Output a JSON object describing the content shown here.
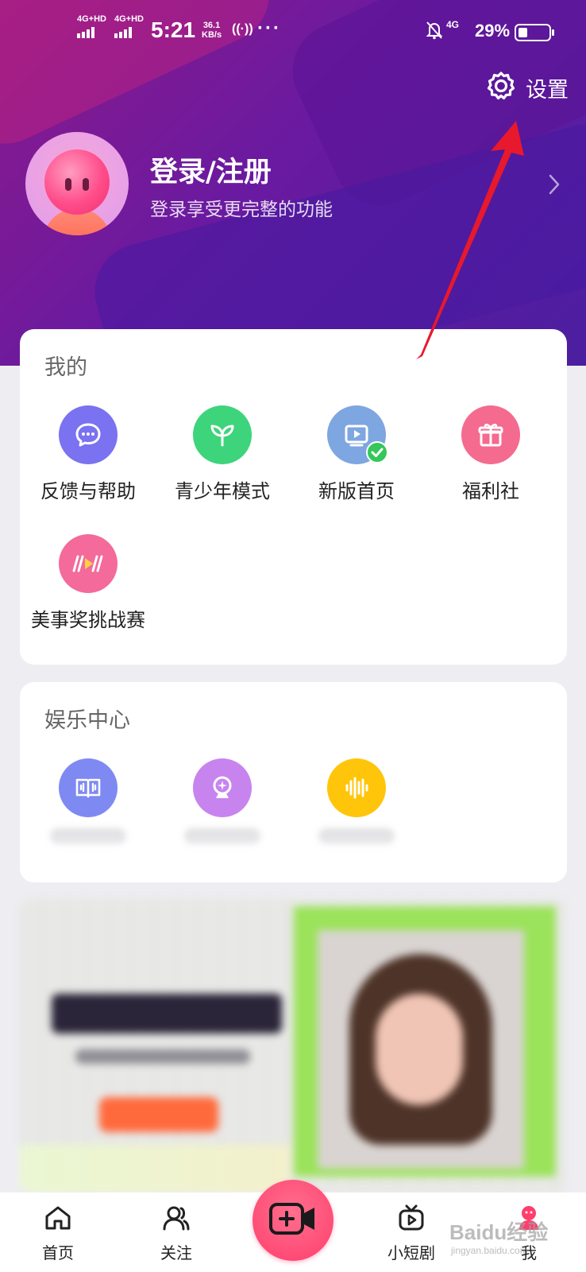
{
  "status_bar": {
    "signal1": "4G+HD",
    "signal2": "4G+HD",
    "time": "5:21",
    "speed_value": "36.1",
    "speed_unit": "KB/s",
    "more": "···",
    "network": "4G",
    "battery_percent": "29%",
    "battery_level": 0.29
  },
  "header": {
    "settings_label": "设置",
    "login_title": "登录/注册",
    "login_subtitle": "登录享受更完整的功能"
  },
  "mine_section": {
    "title": "我的",
    "items": [
      {
        "label": "反馈与帮助",
        "icon": "chat-bubble-icon",
        "color": "#7a72f0"
      },
      {
        "label": "青少年模式",
        "icon": "sprout-icon",
        "color": "#3ed47c"
      },
      {
        "label": "新版首页",
        "icon": "play-screen-icon",
        "color": "#7ea6e0",
        "badge": "check-badge-icon"
      },
      {
        "label": "福利社",
        "icon": "gift-icon",
        "color": "#f56a8f"
      },
      {
        "label": "美事奖挑战赛",
        "icon": "zebra-play-icon",
        "color": "#f36a9b"
      }
    ]
  },
  "entertainment_section": {
    "title": "娱乐中心",
    "items": [
      {
        "icon": "audio-book-icon",
        "color": "#7e8af2"
      },
      {
        "icon": "crystal-ball-icon",
        "color": "#c884ee"
      },
      {
        "icon": "sound-wave-icon",
        "color": "#ffc50a"
      }
    ]
  },
  "bottom_nav": {
    "items": [
      {
        "label": "首页",
        "icon": "home-icon"
      },
      {
        "label": "关注",
        "icon": "follow-icon"
      },
      {
        "label": "",
        "icon": "record-video-icon"
      },
      {
        "label": "小短剧",
        "icon": "short-drama-icon"
      },
      {
        "label": "我",
        "icon": "me-icon"
      }
    ]
  },
  "watermark": {
    "text": "Baidu经验",
    "url_text": "jingyan.baidu.com"
  },
  "colors": {
    "header_start": "#8c1a8a",
    "header_end": "#4b1ea0",
    "annotation_arrow": "#e8182d",
    "record_button": "#ff3e6c"
  }
}
